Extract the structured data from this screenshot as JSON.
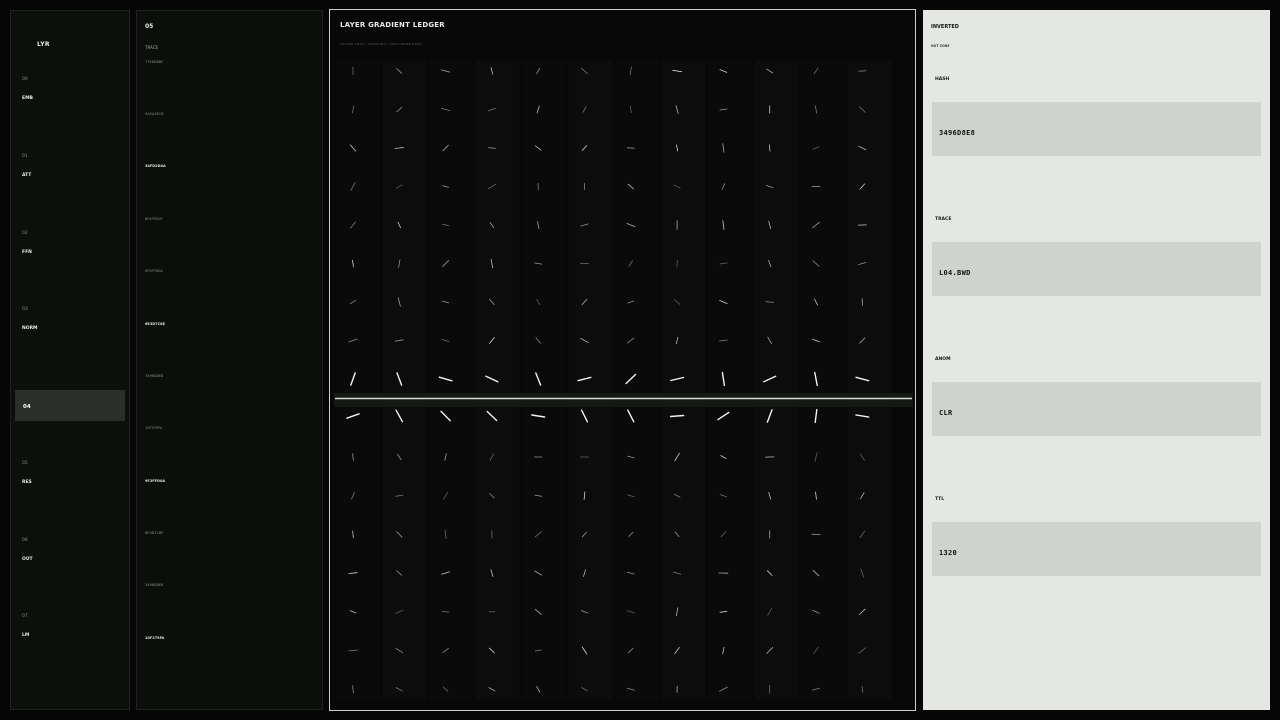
{
  "rail": {
    "brand": "LYR",
    "layers": [
      {
        "num": "00",
        "code": "EMB"
      },
      {
        "num": "01",
        "code": "ATT"
      },
      {
        "num": "02",
        "code": "FFN"
      },
      {
        "num": "03",
        "code": "NORM"
      },
      {
        "num": "04",
        "code": ""
      },
      {
        "num": "05",
        "code": "RES"
      },
      {
        "num": "06",
        "code": "OUT"
      },
      {
        "num": "07",
        "code": "LM"
      }
    ]
  },
  "trace": {
    "layer_id": "05",
    "label": "TRACE",
    "hashes": [
      "77E8D88C",
      "9A5A3ECB",
      "34FD2D4A",
      "6F4F9519",
      "9F2FFD0A",
      "6E3D7C8E",
      "3496D8E8",
      "10F379FA",
      "9F2FFD0A",
      "6E3D7C8E",
      "3496D8E8",
      "10F379FA"
    ]
  },
  "field": {
    "title": "LAYER GRADIENT LEDGER",
    "subtitle": "VECTOR FIELD  /  SIGNALING  /  HIGH-ORDER GRAD"
  },
  "inverted": {
    "heading": "INVERTED",
    "zone": "NOT ZONE",
    "fields": [
      {
        "label": "HASH",
        "value": "3496D8E8"
      },
      {
        "label": "TRACE",
        "value": "L04.BWD"
      },
      {
        "label": "ANOM",
        "value": "CLR"
      },
      {
        "label": "TTL",
        "value": "1320"
      }
    ]
  },
  "colors": {
    "background": "#050605",
    "panel": "#0c0f0c",
    "accent": "#ffffff",
    "inverted_bg": "#e5e7e3",
    "inverted_box": "#d0d2cd"
  }
}
